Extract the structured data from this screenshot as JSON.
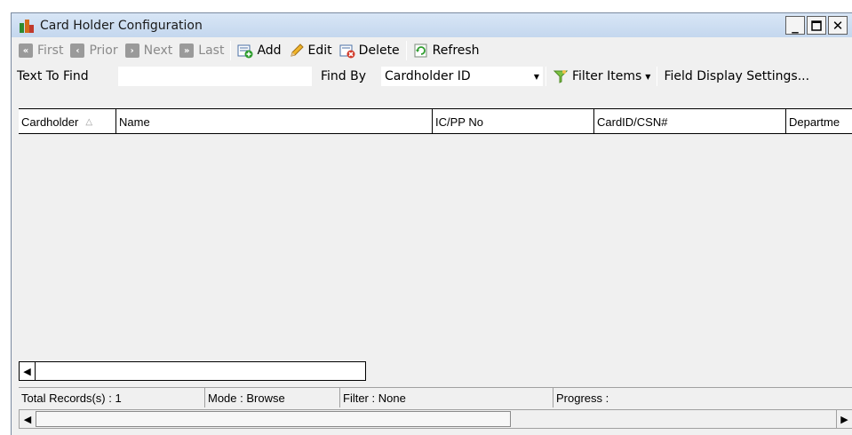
{
  "window": {
    "title": "Card Holder Configuration",
    "controls": {
      "minimize": "_",
      "maximize": "☐",
      "close": "✕"
    }
  },
  "toolbar": {
    "first_label": "First",
    "prior_label": "Prior",
    "next_label": "Next",
    "last_label": "Last",
    "add_label": "Add",
    "edit_label": "Edit",
    "delete_label": "Delete",
    "refresh_label": "Refresh"
  },
  "find": {
    "text_to_find_label": "Text To Find",
    "text_to_find_value": "",
    "find_by_label": "Find By",
    "find_by_value": "Cardholder ID",
    "filter_items_label": "Filter Items",
    "field_display_label": "Field Display Settings..."
  },
  "grid": {
    "columns": [
      {
        "label": "Cardholder",
        "sorted": "asc"
      },
      {
        "label": "Name"
      },
      {
        "label": "IC/PP No"
      },
      {
        "label": "CardID/CSN#"
      },
      {
        "label": "Departme"
      }
    ]
  },
  "status": {
    "total_records": "Total Records(s) : 1",
    "mode": "Mode : Browse",
    "filter": "Filter : None",
    "progress": "Progress :"
  },
  "icons": {
    "app": "card-holder-app-icon",
    "nav_first": "first-record-icon",
    "nav_prior": "prior-record-icon",
    "nav_next": "next-record-icon",
    "nav_last": "last-record-icon",
    "add": "add-record-icon",
    "edit": "pencil-icon",
    "delete": "delete-record-icon",
    "refresh": "refresh-icon",
    "filter": "funnel-icon"
  },
  "colors": {
    "titlebar": "#c4d7ee",
    "window_bg": "#f0f0f0",
    "disabled_text": "#8a8a8a"
  }
}
